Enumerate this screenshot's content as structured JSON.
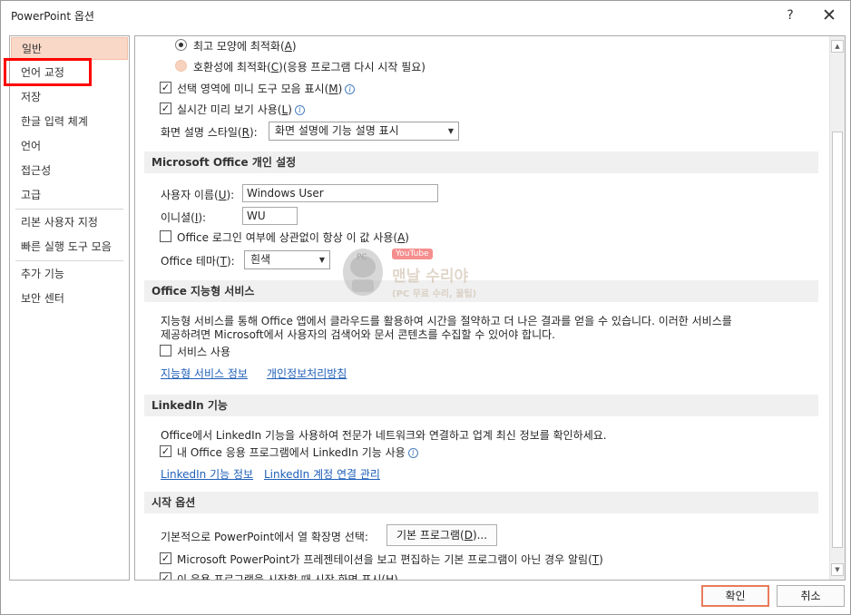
{
  "window": {
    "title": "PowerPoint 옵션",
    "help": "?",
    "close": "✕"
  },
  "nav": {
    "items": [
      {
        "label": "일반"
      },
      {
        "label": "언어 교정"
      },
      {
        "label": "저장"
      },
      {
        "label": "한글 입력 체계"
      },
      {
        "label": "언어"
      },
      {
        "label": "접근성"
      },
      {
        "label": "고급"
      },
      {
        "label": "리본 사용자 지정"
      },
      {
        "label": "빠른 실행 도구 모음"
      },
      {
        "label": "추가 기능"
      },
      {
        "label": "보안 센터"
      }
    ]
  },
  "ui_options": {
    "optimize_best_label": "최고 모양에 최적화(",
    "optimize_best_key": "A",
    "optimize_compat_label": "호환성에 최적화(",
    "optimize_compat_key": "C",
    "optimize_compat_suffix": ")(응용 프로그램 다시 시작 필요)",
    "mini_toolbar_label": "선택 영역에 미니 도구 모음 표시(",
    "mini_toolbar_key": "M",
    "live_preview_label": "실시간 미리 보기 사용(",
    "live_preview_key": "L",
    "screentip_label": "화면 설명 스타일(",
    "screentip_key": "R",
    "screentip_value": "화면 설명에 기능 설명 표시"
  },
  "personalize": {
    "header": "Microsoft Office 개인 설정",
    "username_label": "사용자 이름(",
    "username_key": "U",
    "username_value": "Windows User",
    "initials_label": "이니셜(",
    "initials_key": "I",
    "initials_value": "WU",
    "always_use_label": "Office 로그인 여부에 상관없이 항상 이 값 사용(",
    "always_use_key": "A",
    "theme_label": "Office 테마(",
    "theme_key": "T",
    "theme_value": "흰색"
  },
  "intelligent": {
    "header": "Office 지능형 서비스",
    "description_line1": "지능형 서비스를 통해 Office 앱에서 클라우드를 활용하여 시간을 절약하고 더 나은 결과를 얻을 수 있습니다. 이러한 서비스를",
    "description_line2": "제공하려면 Microsoft에서 사용자의 검색어와 문서 콘텐츠를 수집할 수 있어야 합니다.",
    "enable_label": "서비스 사용",
    "link_about": "지능형 서비스 정보",
    "link_privacy": "개인정보처리방침"
  },
  "linkedin": {
    "header": "LinkedIn 기능",
    "description": "Office에서 LinkedIn 기능을 사용하여 전문가 네트워크와 연결하고 업계 최신 정보를 확인하세요.",
    "enable_label": "내 Office 응용 프로그램에서 LinkedIn 기능 사용",
    "link_about": "LinkedIn 기능 정보",
    "link_manage": "LinkedIn 계정 연결 관리"
  },
  "startup": {
    "header": "시작 옵션",
    "default_ext_label": "기본적으로 PowerPoint에서 열 확장명 선택:",
    "default_programs_btn": "기본 프로그램(",
    "default_programs_key": "D",
    "default_programs_suffix": ")...",
    "notify_label": "Microsoft PowerPoint가 프레젠테이션을 보고 편집하는 기본 프로그램이 아닌 경우 알림(",
    "notify_key": "T",
    "start_screen_label": "이 응용 프로그램을 시작할 때 시작 화면 표시(",
    "start_screen_key": "H"
  },
  "watermark": {
    "badge": "YouTube",
    "title": "맨날 수리야",
    "subtitle": "(PC 무료 수리, 꿀팁)"
  },
  "footer": {
    "ok": "확인",
    "cancel": "취소"
  },
  "colors": {
    "accent": "#e97b5a",
    "nav_active": "#f9d8c8",
    "highlight": "#ff0000",
    "link": "#1f5fb8"
  }
}
